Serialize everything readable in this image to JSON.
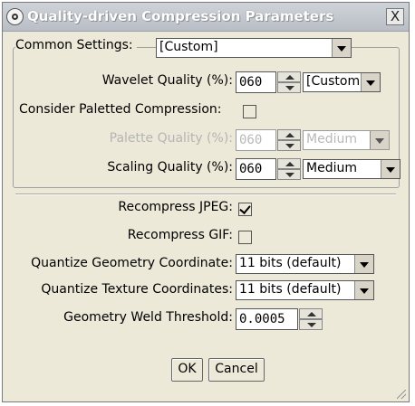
{
  "window": {
    "title": "Quality-driven Compression Parameters",
    "close_glyph": "X",
    "icon": "settings-icon"
  },
  "common": {
    "legend": "Common Settings:",
    "preset_value": "[Custom]"
  },
  "wavelet": {
    "label": "Wavelet Quality (%):",
    "value": "060",
    "preset": "[Custom]"
  },
  "paletted": {
    "label": "Consider Paletted Compression:",
    "checked": false
  },
  "palette_quality": {
    "label": "Palette Quality (%):",
    "value": "060",
    "preset": "Medium",
    "disabled": true
  },
  "scaling": {
    "label": "Scaling Quality (%):",
    "value": "060",
    "preset": "Medium"
  },
  "recompress_jpeg": {
    "label": "Recompress JPEG:",
    "checked": true
  },
  "recompress_gif": {
    "label": "Recompress GIF:",
    "checked": false
  },
  "quantize_geometry": {
    "label": "Quantize Geometry Coordinate:",
    "value": "11 bits (default)"
  },
  "quantize_texture": {
    "label": "Quantize Texture Coordinates:",
    "value": "11 bits (default)"
  },
  "weld": {
    "label": "Geometry Weld Threshold:",
    "value": "0.0005"
  },
  "buttons": {
    "ok": "OK",
    "cancel": "Cancel"
  }
}
